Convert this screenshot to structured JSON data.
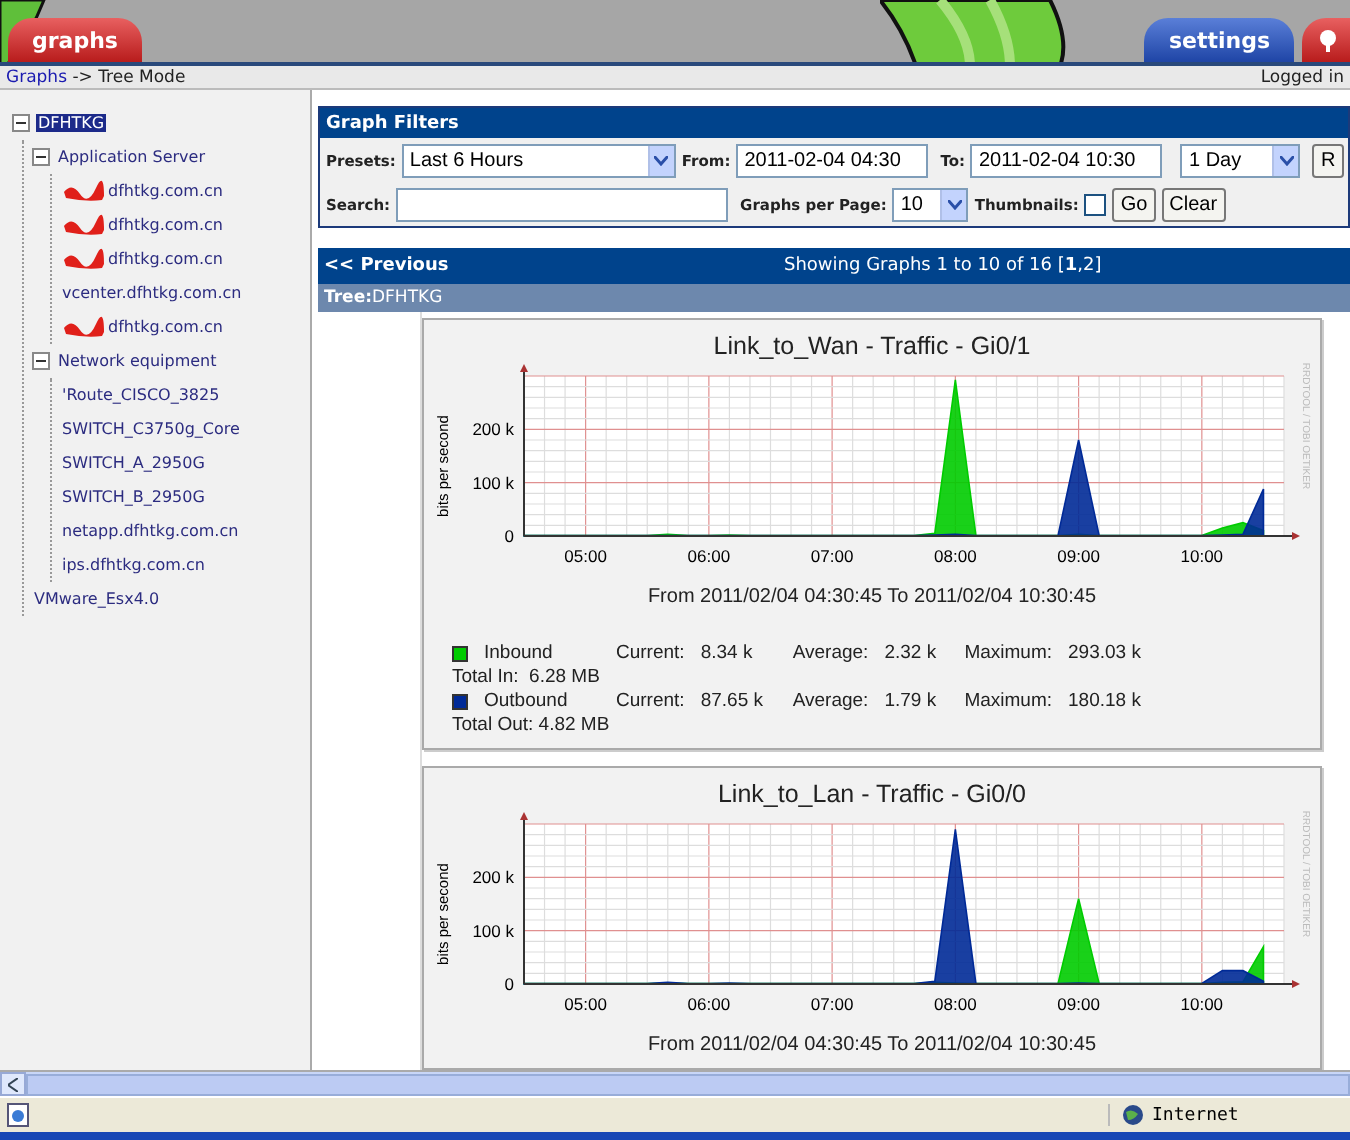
{
  "header": {
    "tabs": [
      {
        "label": "graphs",
        "selected": true
      },
      {
        "label": "settings",
        "selected": false
      }
    ],
    "view_tabs": [
      {
        "selected": true
      }
    ]
  },
  "breadcrumb": {
    "link": "Graphs",
    "trail": "-> Tree Mode",
    "user": "Logged in"
  },
  "tree": [
    {
      "label": "DFHTKG",
      "selected": true,
      "expanded": true,
      "children": [
        {
          "label": "Application Server",
          "selected": false,
          "expanded": true,
          "children": [
            {
              "label": "dfhtkg.com.cn",
              "selected": false,
              "redacted": true
            },
            {
              "label": "dfhtkg.com.cn",
              "selected": false,
              "redacted": true
            },
            {
              "label": "dfhtkg.com.cn",
              "selected": false,
              "redacted": true
            },
            {
              "label": "vcenter.dfhtkg.com.cn",
              "selected": false,
              "redacted": false
            },
            {
              "label": "dfhtkg.com.cn",
              "selected": false,
              "redacted": true
            }
          ]
        },
        {
          "label": "Network equipment",
          "selected": false,
          "expanded": true,
          "children": [
            {
              "label": "'Route_CISCO_3825",
              "selected": false,
              "redacted": false
            },
            {
              "label": "SWITCH_C3750g_Core",
              "selected": false,
              "redacted": false
            },
            {
              "label": "SWITCH_A_2950G",
              "selected": false,
              "redacted": false
            },
            {
              "label": "SWITCH_B_2950G",
              "selected": false,
              "redacted": false
            },
            {
              "label": "netapp.dfhtkg.com.cn",
              "selected": false,
              "redacted": false
            },
            {
              "label": "ips.dfhtkg.com.cn",
              "selected": false,
              "redacted": false
            }
          ]
        },
        {
          "label": "VMware_Esx4.0",
          "selected": false
        }
      ]
    }
  ],
  "filters": {
    "title": "Graph Filters",
    "presets_label": "Presets:",
    "preset": "Last 6 Hours",
    "from_label": "From:",
    "from": "2011-02-04 04:30",
    "to_label": "To:",
    "to": "2011-02-04 10:30",
    "span": "1 Day",
    "refresh_button": "R",
    "search_label": "Search:",
    "per_page_label": "Graphs per Page:",
    "per_page": "10",
    "thumbnails_label": "Thumbnails:",
    "thumbnails": false,
    "go_button": "Go",
    "clear_button": "Clear"
  },
  "pager": {
    "previous": "<< Previous",
    "showing": "Showing Graphs 1 to 10 of 16 [**1**,2]"
  },
  "tree_header": "**Tree:**DFHTKG",
  "graphs": [
    {
      "title": "Link_to_Wan - Traffic - Gi0/1",
      "range": "From 2011/02/04 04:30:45 To 2011/02/04 10:30:45",
      "credit": "RRDTOOL / TOBI OETIKER",
      "chart_data": {
        "type": "area",
        "grid": true,
        "ylabel": "bits per second",
        "x": [
          270,
          280,
          290,
          300,
          310,
          320,
          330,
          340,
          350,
          360,
          370,
          380,
          390,
          400,
          410,
          420,
          430,
          440,
          450,
          460,
          470,
          480,
          490,
          500,
          510,
          520,
          530,
          540,
          550,
          560,
          570,
          580,
          590,
          600,
          610,
          620,
          630
        ],
        "ylim": [
          0,
          300
        ],
        "xlim": [
          270,
          640
        ],
        "xticks": [
          {
            "value": 300,
            "label": "05:00"
          },
          {
            "value": 360,
            "label": "06:00"
          },
          {
            "value": 420,
            "label": "07:00"
          },
          {
            "value": 480,
            "label": "08:00"
          },
          {
            "value": 540,
            "label": "09:00"
          },
          {
            "value": 600,
            "label": "10:00"
          }
        ],
        "yticks": [
          {
            "value": 0,
            "label": "0"
          },
          {
            "value": 100,
            "label": "100 k"
          },
          {
            "value": 200,
            "label": "200 k"
          }
        ],
        "series": [
          {
            "name": "Inbound",
            "color": "#00cc00",
            "values": [
              1,
              1,
              1,
              1,
              1,
              1,
              1,
              3,
              1,
              1,
              2,
              1,
              1,
              1,
              1,
              1,
              1,
              1,
              1,
              1,
              5,
              293,
              1,
              1,
              1,
              1,
              1,
              3,
              1,
              1,
              1,
              1,
              1,
              1,
              15,
              25,
              10
            ]
          },
          {
            "name": "Outbound",
            "color": "#002a97",
            "values": [
              1,
              1,
              1,
              1,
              1,
              1,
              1,
              1,
              1,
              1,
              1,
              1,
              1,
              1,
              1,
              1,
              1,
              1,
              1,
              1,
              2,
              3,
              1,
              1,
              1,
              1,
              1,
              180,
              1,
              1,
              1,
              1,
              1,
              1,
              2,
              3,
              88
            ]
          }
        ]
      },
      "legend": [
        {
          "color": "#00cc00",
          "current_label": "Current:",
          "current": "8.34 k",
          "average_label": "Average:",
          "average": "2.32 k",
          "maximum_label": "Maximum:",
          "maximum": "293.03 k",
          "total": "Total In:  6.28 MB"
        },
        {
          "color": "#002a97",
          "current_label": "Current:",
          "current": "87.65 k",
          "average_label": "Average:",
          "average": "1.79 k",
          "maximum_label": "Maximum:",
          "maximum": "180.18 k",
          "total": "Total Out: 4.82 MB"
        }
      ]
    },
    {
      "title": "Link_to_Lan - Traffic - Gi0/0",
      "range": "From 2011/02/04 04:30:45 To 2011/02/04 10:30:45",
      "credit": "RRDTOOL / TOBI OETIKER",
      "chart_data": {
        "type": "area",
        "grid": true,
        "ylabel": "bits per second",
        "x": [
          270,
          280,
          290,
          300,
          310,
          320,
          330,
          340,
          350,
          360,
          370,
          380,
          390,
          400,
          410,
          420,
          430,
          440,
          450,
          460,
          470,
          480,
          490,
          500,
          510,
          520,
          530,
          540,
          550,
          560,
          570,
          580,
          590,
          600,
          610,
          620,
          630
        ],
        "ylim": [
          0,
          300
        ],
        "xlim": [
          270,
          640
        ],
        "xticks": [
          {
            "value": 300,
            "label": "05:00"
          },
          {
            "value": 360,
            "label": "06:00"
          },
          {
            "value": 420,
            "label": "07:00"
          },
          {
            "value": 480,
            "label": "08:00"
          },
          {
            "value": 540,
            "label": "09:00"
          },
          {
            "value": 600,
            "label": "10:00"
          }
        ],
        "yticks": [
          {
            "value": 0,
            "label": "0"
          },
          {
            "value": 100,
            "label": "100 k"
          },
          {
            "value": 200,
            "label": "200 k"
          }
        ],
        "series": [
          {
            "color": "#00cc00",
            "values": [
              1,
              1,
              1,
              1,
              1,
              1,
              1,
              2,
              1,
              1,
              1,
              1,
              1,
              1,
              1,
              1,
              1,
              1,
              1,
              1,
              3,
              2,
              1,
              1,
              1,
              1,
              1,
              160,
              1,
              1,
              1,
              1,
              1,
              1,
              3,
              4,
              70
            ]
          },
          {
            "color": "#002a97",
            "values": [
              1,
              1,
              1,
              1,
              1,
              1,
              1,
              3,
              1,
              1,
              2,
              1,
              1,
              1,
              1,
              1,
              1,
              1,
              1,
              1,
              5,
              290,
              1,
              1,
              1,
              1,
              1,
              2,
              1,
              1,
              1,
              1,
              1,
              1,
              25,
              25,
              5
            ]
          }
        ]
      }
    }
  ],
  "status_bar": {
    "zone": "Internet"
  }
}
